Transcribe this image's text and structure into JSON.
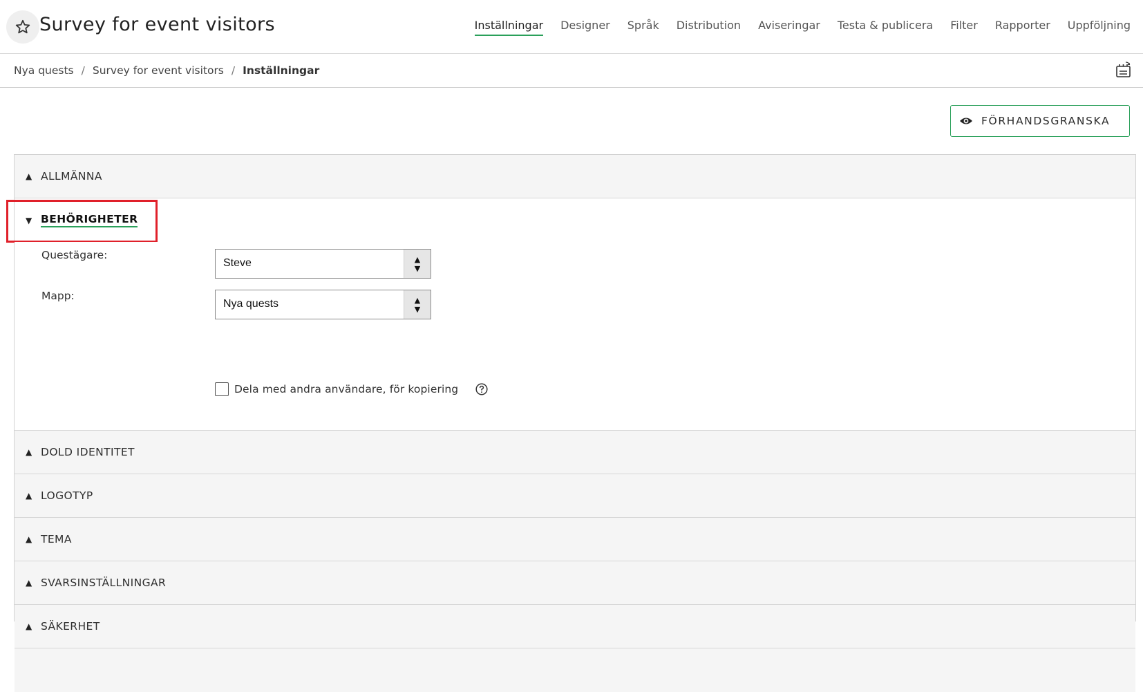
{
  "header": {
    "title": "Survey for event visitors",
    "nav": [
      {
        "label": "Inställningar",
        "active": true
      },
      {
        "label": "Designer"
      },
      {
        "label": "Språk"
      },
      {
        "label": "Distribution"
      },
      {
        "label": "Aviseringar"
      },
      {
        "label": "Testa & publicera"
      },
      {
        "label": "Filter"
      },
      {
        "label": "Rapporter"
      },
      {
        "label": "Uppföljning"
      }
    ]
  },
  "breadcrumb": {
    "items": [
      "Nya quests",
      "Survey for event visitors"
    ],
    "separator": "/",
    "current": "Inställningar"
  },
  "preview_button": {
    "label": "FÖRHANDSGRANSKA"
  },
  "sections": {
    "general": "ALLMÄNNA",
    "permissions": "BEHÖRIGHETER",
    "hidden_identity": "DOLD IDENTITET",
    "logotype": "LOGOTYP",
    "theme": "TEMA",
    "response_settings": "SVARSINSTÄLLNINGAR",
    "security": "SÄKERHET"
  },
  "permissions": {
    "owner_label": "Questägare:",
    "owner_value": "Steve",
    "folder_label": "Mapp:",
    "folder_value": "Nya quests",
    "share_label": "Dela med andra användare, för kopiering",
    "share_checked": false
  },
  "colors": {
    "accent": "#2aa05a",
    "highlight": "#e0202a",
    "section_bg": "#f5f5f5"
  }
}
